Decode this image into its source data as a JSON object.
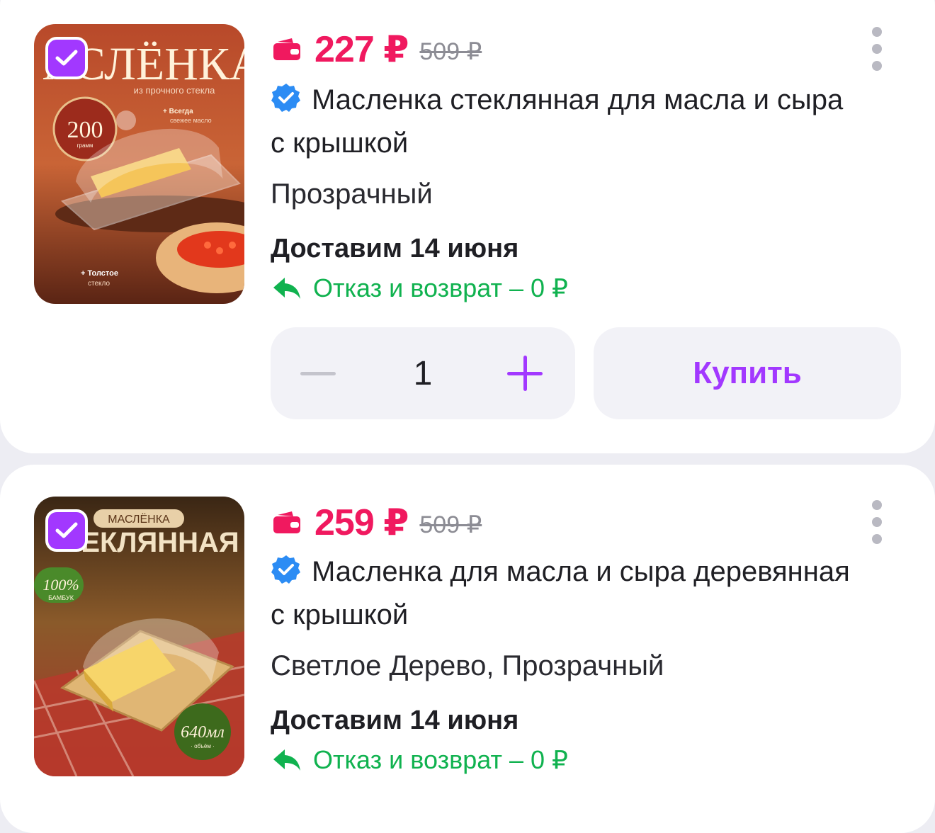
{
  "colors": {
    "accent": "#a238ff",
    "price": "#f0195f",
    "return": "#10b24f",
    "verified": "#2c8cf4"
  },
  "products": [
    {
      "price": "227 ₽",
      "old_price": "509 ₽",
      "title": "Масленка стеклянная для масла и сыра с крышкой",
      "variant": "Прозрачный",
      "delivery": "Доставим 14 июня",
      "return_policy": "Отказ и возврат – 0 ₽",
      "quantity": "1",
      "buy_label": "Купить",
      "image_text": {
        "banner": "АСЛЁНКА",
        "sub": "из прочного стекла",
        "badge_num": "200",
        "badge_unit": "грамм",
        "note1": "+ Всегда",
        "note1b": "свежее масло",
        "note2": "+ Толстое",
        "note2b": "стекло"
      }
    },
    {
      "price": "259 ₽",
      "old_price": "509 ₽",
      "title": "Масленка для масла и сыра деревянная с крышкой",
      "variant": "Светлое Дерево, Прозрачный",
      "delivery": "Доставим 14 июня",
      "return_policy": "Отказ и возврат – 0 ₽",
      "image_text": {
        "pill": "МАСЛЁНКА",
        "banner": "ЕКЛЯННАЯ",
        "badge1": "100%",
        "badge1b": "БАМБУК",
        "badge2": "640мл",
        "badge2b": "· объём ·"
      }
    }
  ]
}
